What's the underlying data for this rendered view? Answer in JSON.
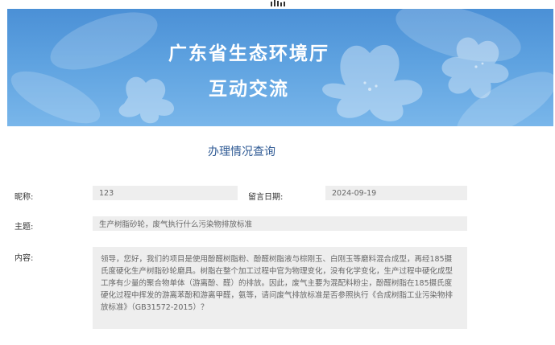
{
  "banner": {
    "title_line1": "广东省生态环境厅",
    "title_line2": "互动交流"
  },
  "section_title": "办理情况查询",
  "form": {
    "nickname_label": "昵称:",
    "nickname_value": "123",
    "date_label": "留言日期:",
    "date_value": "2024-09-19",
    "subject_label": "主题:",
    "subject_value": "生产树脂砂轮，废气执行什么污染物排放标准",
    "content_label": "内容:",
    "content_value": "领导，您好，我们的项目是使用酚醛树脂粉、酚醛树脂液与棕刚玉、白刚玉等磨料混合成型，再经185摄氏度硬化生产树脂砂轮磨具。树脂在整个加工过程中官为物理变化，没有化学变化，生产过程中硬化成型工序有少量的聚合物单体（游离酚、醛）的排放。因此，废气主要为混配料粉尘，酚醛树脂在185摄氏度硬化过程中挥发的游离苯酚和游离甲醛，氨等，请问废气排放标准是否参照执行《合成树脂工业污染物排放标准》（GB31572-2015）？"
  },
  "colors": {
    "banner_top": "#4b90d6",
    "banner_bottom": "#79b6ea",
    "section_title": "#2f5a94",
    "field_bg": "#eeeeee"
  },
  "icons": {
    "top_logo": "site-logo-icon",
    "banner_decoration": "lily-flower-icon"
  }
}
